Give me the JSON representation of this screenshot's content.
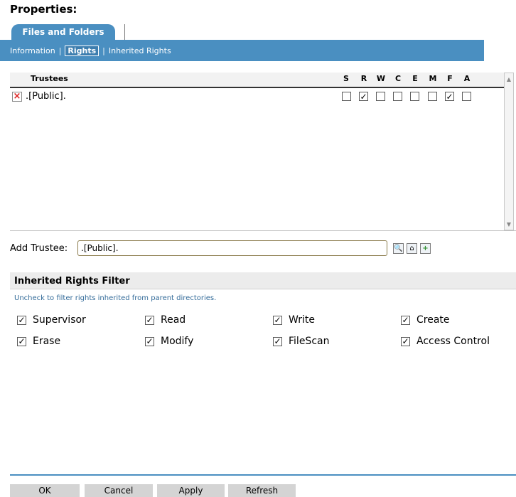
{
  "page": {
    "title": "Properties:"
  },
  "tab": {
    "label": "Files and Folders"
  },
  "subnav": {
    "items": [
      "Information",
      "Rights",
      "Inherited Rights"
    ],
    "separator": "|"
  },
  "rights_table": {
    "header": "Trustees",
    "columns": [
      "S",
      "R",
      "W",
      "C",
      "E",
      "M",
      "F",
      "A"
    ],
    "rows": [
      {
        "trustee": ".[Public].",
        "checked": [
          false,
          true,
          false,
          false,
          false,
          false,
          true,
          false
        ]
      }
    ]
  },
  "add_trustee": {
    "label": "Add Trustee:",
    "value": ".[Public]."
  },
  "inherited_filter": {
    "title": "Inherited Rights Filter",
    "description": "Uncheck to filter rights inherited from parent directories.",
    "items": [
      {
        "label": "Supervisor",
        "checked": true
      },
      {
        "label": "Read",
        "checked": true
      },
      {
        "label": "Write",
        "checked": true
      },
      {
        "label": "Create",
        "checked": true
      },
      {
        "label": "Erase",
        "checked": true
      },
      {
        "label": "Modify",
        "checked": true
      },
      {
        "label": "FileScan",
        "checked": true
      },
      {
        "label": "Access Control",
        "checked": true
      }
    ]
  },
  "buttons": {
    "ok": "OK",
    "cancel": "Cancel",
    "apply": "Apply",
    "refresh": "Refresh"
  },
  "colors": {
    "accent": "#4a8fc1"
  }
}
